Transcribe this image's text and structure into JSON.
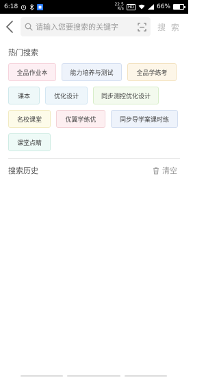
{
  "status_bar": {
    "time": "6:18",
    "net_speed_top": "22.5",
    "net_speed_unit": "K/s",
    "network_type": "HD",
    "battery": "66%",
    "battery_level": 0.66
  },
  "search": {
    "placeholder": "请输入您要搜索的关键字",
    "submit_label": "搜 索"
  },
  "hot_search": {
    "title": "热门搜索",
    "tags": [
      {
        "label": "全品作业本",
        "bg": "#fdeff3",
        "border": "#f6d3dc"
      },
      {
        "label": "能力培养与测试",
        "bg": "#eef3fb",
        "border": "#d3def0"
      },
      {
        "label": "全品学练考",
        "bg": "#fdf6e8",
        "border": "#f3e2bf"
      },
      {
        "label": "课本",
        "bg": "#eef8f9",
        "border": "#cfe8eb"
      },
      {
        "label": "优化设计",
        "bg": "#eef6fb",
        "border": "#d3e6f2"
      },
      {
        "label": "同步测控优化设计",
        "bg": "#f3faee",
        "border": "#d9eecb"
      },
      {
        "label": "名校课堂",
        "bg": "#fdfbe9",
        "border": "#f2ebc1"
      },
      {
        "label": "优翼学练优",
        "bg": "#fdeff1",
        "border": "#f3d2d7"
      },
      {
        "label": "同步导学案课时练",
        "bg": "#eef3fb",
        "border": "#d3def0"
      },
      {
        "label": "课堂点睛",
        "bg": "#eefaf7",
        "border": "#cfece4"
      }
    ]
  },
  "history": {
    "title": "搜索历史",
    "clear_label": "清空"
  }
}
